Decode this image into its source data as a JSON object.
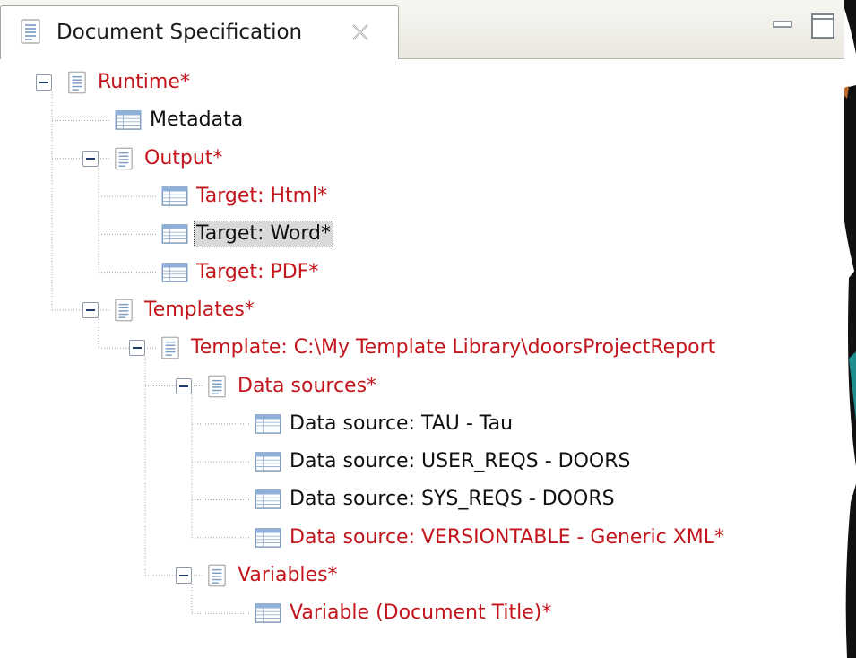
{
  "view": {
    "title": "Document Specification",
    "tab_icon": "document-icon",
    "close_icon": "close-icon",
    "minimize_icon": "minimize-icon",
    "maximize_icon": "maximize-icon"
  },
  "colors": {
    "dirty_text": "#c3161c",
    "clean_text": "#101010",
    "selection_bg": "#d9d9d9",
    "tree_line": "#a0a0a0",
    "toggle_border": "#8d9aaa"
  },
  "tree": [
    {
      "id": "runtime",
      "label": "Runtime*",
      "icon": "document-icon",
      "depth": 0,
      "expanded": true,
      "dirty": true
    },
    {
      "id": "metadata",
      "label": "Metadata",
      "icon": "table-icon",
      "depth": 1,
      "dirty": false
    },
    {
      "id": "output",
      "label": "Output*",
      "icon": "document-icon",
      "depth": 1,
      "expanded": true,
      "dirty": true
    },
    {
      "id": "target-html",
      "label": "Target: Html*",
      "icon": "table-icon",
      "depth": 2,
      "dirty": true
    },
    {
      "id": "target-word",
      "label": "Target: Word*",
      "icon": "table-icon",
      "depth": 2,
      "dirty": false,
      "selected": true
    },
    {
      "id": "target-pdf",
      "label": "Target: PDF*",
      "icon": "table-icon",
      "depth": 2,
      "dirty": true
    },
    {
      "id": "templates",
      "label": "Templates*",
      "icon": "document-icon",
      "depth": 1,
      "expanded": true,
      "dirty": true
    },
    {
      "id": "template-file",
      "label": "Template: C:\\My Template Library\\doorsProjectReport",
      "icon": "document-icon",
      "depth": 2,
      "expanded": true,
      "dirty": true
    },
    {
      "id": "data-sources",
      "label": "Data sources*",
      "icon": "document-icon",
      "depth": 3,
      "expanded": true,
      "dirty": true
    },
    {
      "id": "ds-tau",
      "label": "Data source: TAU - Tau",
      "icon": "table-icon",
      "depth": 4,
      "dirty": false
    },
    {
      "id": "ds-user-reqs",
      "label": "Data source: USER_REQS - DOORS",
      "icon": "table-icon",
      "depth": 4,
      "dirty": false
    },
    {
      "id": "ds-sys-reqs",
      "label": "Data source: SYS_REQS - DOORS",
      "icon": "table-icon",
      "depth": 4,
      "dirty": false
    },
    {
      "id": "ds-versiontable",
      "label": "Data source: VERSIONTABLE - Generic XML*",
      "icon": "table-icon",
      "depth": 4,
      "dirty": true
    },
    {
      "id": "variables",
      "label": "Variables*",
      "icon": "document-icon",
      "depth": 3,
      "expanded": true,
      "dirty": true
    },
    {
      "id": "var-doc-title",
      "label": "Variable (Document Title)*",
      "icon": "table-icon",
      "depth": 4,
      "dirty": true
    }
  ]
}
